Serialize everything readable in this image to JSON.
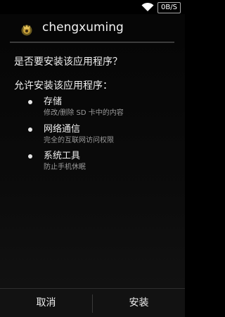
{
  "status_bar": {
    "wifi_icon": "wifi-icon",
    "network_speed": "0B/S"
  },
  "header": {
    "app_icon": "app-icon",
    "app_name": "chengxuming"
  },
  "dialog": {
    "prompt": "是否要安装该应用程序？",
    "permissions_heading": "允许安装该应用程序：",
    "permissions": [
      {
        "title": "存储",
        "description": "修改/删除 SD 卡中的内容"
      },
      {
        "title": "网络通信",
        "description": "完全的互联网访问权限"
      },
      {
        "title": "系统工具",
        "description": "防止手机休眠"
      }
    ]
  },
  "buttons": {
    "cancel_label": "取消",
    "install_label": "安装"
  },
  "colors": {
    "background": "#000000",
    "primary_text": "#f0f0f0",
    "secondary_text": "#9a9a9a",
    "divider": "#3b3b3b"
  }
}
